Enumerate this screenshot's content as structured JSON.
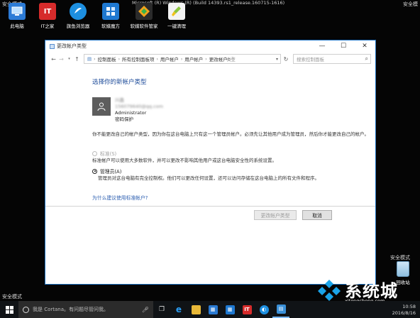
{
  "corners": {
    "top_left": "安全模式",
    "top_right": "安全模",
    "bottom_left": "安全模式",
    "right_mid": "安全模式"
  },
  "build_text": "Microsoft (R) Windows (R) (Build 14393.rs1_release.160715-1616)",
  "desktop_icons": [
    {
      "label": "此电脑",
      "icon": "computer-icon",
      "color": "#2c7bd6",
      "glyph": "▭"
    },
    {
      "label": "IT之家",
      "icon": "ithome-icon",
      "color": "#d62b2b",
      "glyph": "IT"
    },
    {
      "label": "旗鱼浏览器",
      "icon": "browser-icon",
      "color": "#1d8fe0",
      "glyph": "◐"
    },
    {
      "label": "软媒魔方",
      "icon": "cube-icon",
      "color": "#1e78d0",
      "glyph": "▦"
    },
    {
      "label": "软媒软件管家",
      "icon": "software-manager-icon",
      "color": "#f2a31b",
      "glyph": "◆"
    },
    {
      "label": "一键清理",
      "icon": "cleanup-icon",
      "color": "#e8e8e8",
      "glyph": "✎"
    }
  ],
  "window": {
    "title": "更改帐户类型",
    "address_parts": [
      "控制面板",
      "所有控制面板项",
      "用户帐户",
      "更改帐户"
    ],
    "search_placeholder": "搜索控制面板",
    "heading": "选择你的新帐户类型",
    "account": {
      "name_blurred": "兴鑫",
      "email_blurred": "156079640@qq.com",
      "role": "Administrator",
      "protection": "密码保护"
    },
    "intro": "你不能更改自己的帐户类型，因为你在这台电脑上只有这一个管理员帐户。必须先让其他用户成为管理员，然后你才能更改自己的帐户。",
    "options": [
      {
        "label": "标准(S)",
        "desc": "标准帐户可以使用大多数软件，并可以更改不影响其他用户或这台电脑安全性的系统设置。",
        "selected": false,
        "disabled": true
      },
      {
        "label": "管理员(A)",
        "desc": "管理员对这台电脑有完全控制权。他们可以更改任何设置，还可以访问存储在这台电脑上的所有文件和程序。",
        "selected": true,
        "disabled": false
      }
    ],
    "link": "为什么建议使用标准帐户?",
    "change_button": "更改帐户类型",
    "cancel_button": "取消"
  },
  "recycle_bin": "回收站",
  "taskbar": {
    "search_placeholder": "我是 Cortana。有问题尽管问我。",
    "icons": [
      {
        "icon": "task-view-icon",
        "color": "#101316",
        "glyph": "❐"
      },
      {
        "icon": "edge-icon",
        "color": "#1d8fe0",
        "glyph": "e"
      },
      {
        "icon": "file-explorer-icon",
        "color": "#e8b838",
        "glyph": "▬"
      },
      {
        "icon": "store-icon",
        "color": "#2a7ad2",
        "glyph": "▦"
      },
      {
        "icon": "ruanmei-cube-icon",
        "color": "#1e78d0",
        "glyph": "▦"
      },
      {
        "icon": "ithome-taskbar-icon",
        "color": "#d62b2b",
        "glyph": "IT"
      },
      {
        "icon": "fish-browser-icon",
        "color": "#1d8fe0",
        "glyph": "◐"
      },
      {
        "icon": "control-panel-icon",
        "color": "#3a90d8",
        "glyph": "▤"
      }
    ],
    "time": "10:58",
    "date": "2016/8/16"
  },
  "watermark": {
    "text": "系统城",
    "url": "xitongcheng.com"
  }
}
